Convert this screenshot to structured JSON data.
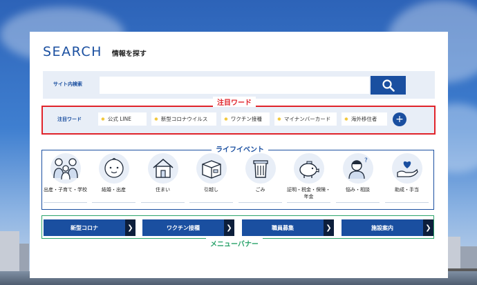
{
  "header": {
    "title_en": "SEARCH",
    "title_jp": "情報を探す"
  },
  "search": {
    "label": "サイト内検索",
    "value": "",
    "placeholder": "",
    "button_icon": "search-icon"
  },
  "keywords": {
    "frame_label": "注目ワード",
    "title": "注目ワード",
    "items": [
      {
        "label": "公式 LINE"
      },
      {
        "label": "新型コロナウイルス"
      },
      {
        "label": "ワクチン接種"
      },
      {
        "label": "マイナンバーカード"
      },
      {
        "label": "海外移住者"
      }
    ],
    "more_icon": "plus-icon"
  },
  "life_events": {
    "frame_label": "ライフイベント",
    "items": [
      {
        "label": "出産・子育て・学校",
        "icon": "family-icon"
      },
      {
        "label": "結婚・出産",
        "icon": "baby-icon"
      },
      {
        "label": "住まい",
        "icon": "house-icon"
      },
      {
        "label": "引越し",
        "icon": "box-icon"
      },
      {
        "label": "ごみ",
        "icon": "trash-icon"
      },
      {
        "label": "証明・税金・保険・年金",
        "icon": "piggy-bank-icon"
      },
      {
        "label": "悩み・相談",
        "icon": "consultation-icon"
      },
      {
        "label": "助成・手当",
        "icon": "heart-hand-icon"
      }
    ]
  },
  "menu_banner": {
    "frame_label": "メニューバナー",
    "items": [
      {
        "label": "新型コロナ"
      },
      {
        "label": "ワクチン接種"
      },
      {
        "label": "職員募集"
      },
      {
        "label": "施設案内"
      }
    ]
  },
  "colors": {
    "brand": "#1a4fa0",
    "keyword_frame": "#e0232a",
    "menu_frame": "#29a36a",
    "panel_bg": "#e8eef7"
  }
}
